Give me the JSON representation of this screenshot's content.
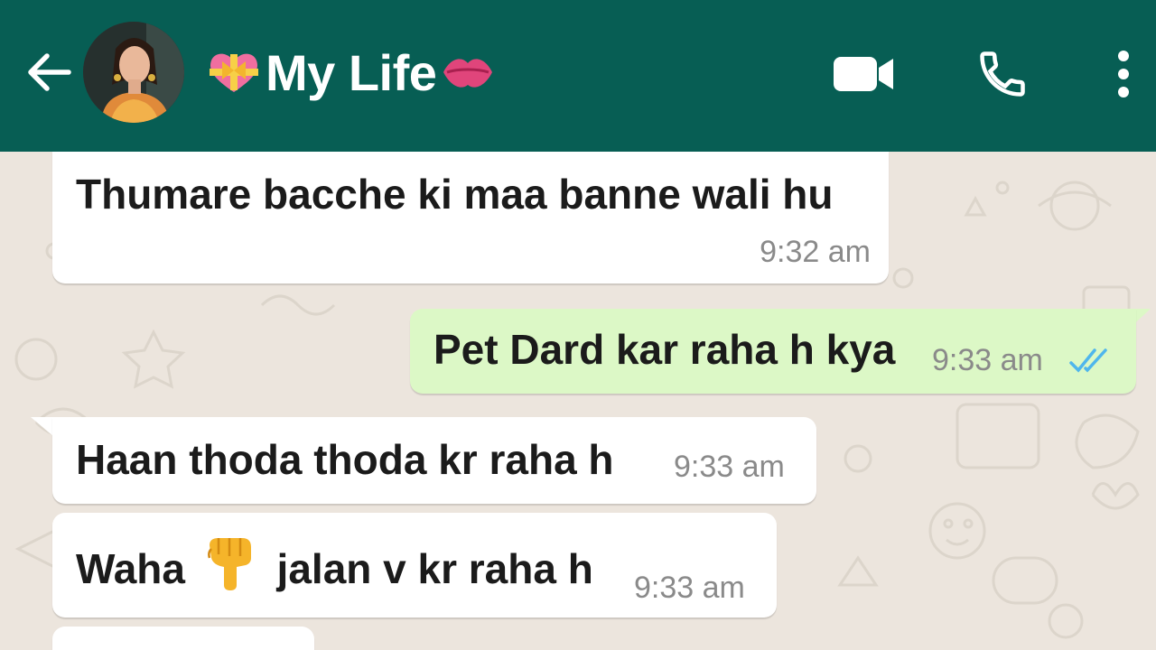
{
  "header": {
    "contact_name": "My Life",
    "title_prefix_icon": "heart-with-ribbon-icon",
    "title_suffix_icon": "kiss-mark-icon",
    "icons": [
      "back-arrow-icon",
      "video-camera-icon",
      "phone-icon",
      "more-vert-icon"
    ],
    "color": "#075e54"
  },
  "messages": [
    {
      "direction": "incoming",
      "text": "Thumare bacche ki maa banne wali hu",
      "time": "9:32 am"
    },
    {
      "direction": "outgoing",
      "text": "Pet Dard kar raha h kya",
      "time": "9:33 am",
      "status": "read"
    },
    {
      "direction": "incoming",
      "text": "Haan thoda thoda kr raha h",
      "time": "9:33 am"
    },
    {
      "direction": "incoming",
      "text_before": "Waha",
      "emoji": "backhand-index-pointing-down-icon",
      "text_after": "jalan v kr raha h",
      "time": "9:33 am"
    }
  ],
  "colors": {
    "incoming_bubble": "#ffffff",
    "outgoing_bubble": "#dcf8c6",
    "read_ticks": "#4fb6ec",
    "chat_background": "#ece5dd"
  }
}
